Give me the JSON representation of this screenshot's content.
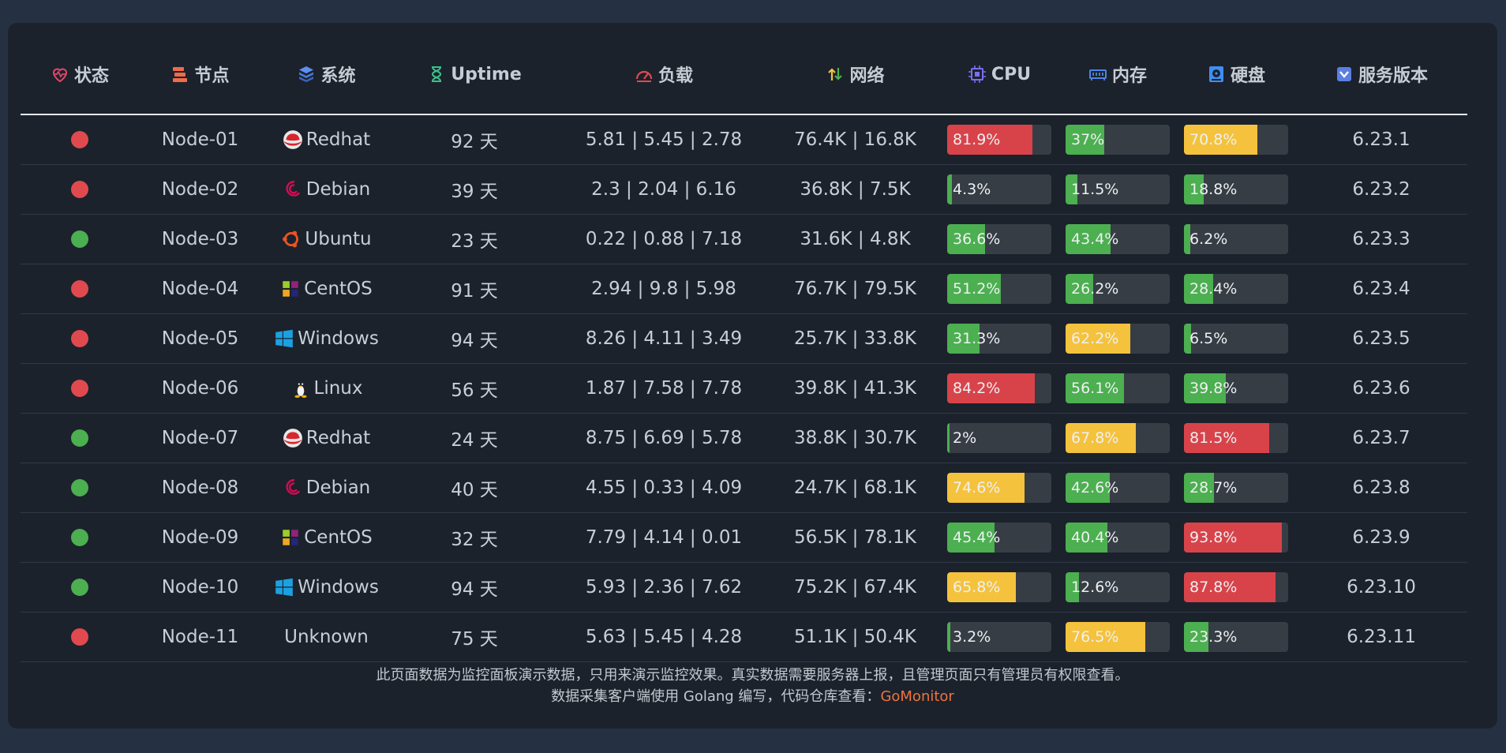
{
  "headers": {
    "status": "状态",
    "node": "节点",
    "system": "系统",
    "uptime": "Uptime",
    "load": "负载",
    "network": "网络",
    "cpu": "CPU",
    "memory": "内存",
    "disk": "硬盘",
    "version": "服务版本"
  },
  "colors": {
    "online": "#4caf50",
    "offline": "#e04a4f",
    "bar_green": "#4caf50",
    "bar_yellow": "#f5c23d",
    "bar_red": "#d8434a",
    "link": "#f0733c"
  },
  "rows": [
    {
      "status": "offline",
      "node": "Node-01",
      "os": "Redhat",
      "os_icon": "redhat-icon",
      "uptime": "92 天",
      "load": "5.81 | 5.45 | 2.78",
      "net": "76.4K | 16.8K",
      "cpu": "81.9%",
      "cpu_value": 81.9,
      "mem": "37%",
      "mem_value": 37,
      "disk": "70.8%",
      "disk_value": 70.8,
      "version": "6.23.1"
    },
    {
      "status": "offline",
      "node": "Node-02",
      "os": "Debian",
      "os_icon": "debian-icon",
      "uptime": "39 天",
      "load": "2.3 | 2.04 | 6.16",
      "net": "36.8K | 7.5K",
      "cpu": "4.3%",
      "cpu_value": 4.3,
      "mem": "11.5%",
      "mem_value": 11.5,
      "disk": "18.8%",
      "disk_value": 18.8,
      "version": "6.23.2"
    },
    {
      "status": "online",
      "node": "Node-03",
      "os": "Ubuntu",
      "os_icon": "ubuntu-icon",
      "uptime": "23 天",
      "load": "0.22 | 0.88 | 7.18",
      "net": "31.6K | 4.8K",
      "cpu": "36.6%",
      "cpu_value": 36.6,
      "mem": "43.4%",
      "mem_value": 43.4,
      "disk": "6.2%",
      "disk_value": 6.2,
      "version": "6.23.3"
    },
    {
      "status": "offline",
      "node": "Node-04",
      "os": "CentOS",
      "os_icon": "centos-icon",
      "uptime": "91 天",
      "load": "2.94 | 9.8 | 5.98",
      "net": "76.7K | 79.5K",
      "cpu": "51.2%",
      "cpu_value": 51.2,
      "mem": "26.2%",
      "mem_value": 26.2,
      "disk": "28.4%",
      "disk_value": 28.4,
      "version": "6.23.4"
    },
    {
      "status": "offline",
      "node": "Node-05",
      "os": "Windows",
      "os_icon": "windows-icon",
      "uptime": "94 天",
      "load": "8.26 | 4.11 | 3.49",
      "net": "25.7K | 33.8K",
      "cpu": "31.3%",
      "cpu_value": 31.3,
      "mem": "62.2%",
      "mem_value": 62.2,
      "disk": "6.5%",
      "disk_value": 6.5,
      "version": "6.23.5"
    },
    {
      "status": "offline",
      "node": "Node-06",
      "os": "Linux",
      "os_icon": "linux-icon",
      "uptime": "56 天",
      "load": "1.87 | 7.58 | 7.78",
      "net": "39.8K | 41.3K",
      "cpu": "84.2%",
      "cpu_value": 84.2,
      "mem": "56.1%",
      "mem_value": 56.1,
      "disk": "39.8%",
      "disk_value": 39.8,
      "version": "6.23.6"
    },
    {
      "status": "online",
      "node": "Node-07",
      "os": "Redhat",
      "os_icon": "redhat-icon",
      "uptime": "24 天",
      "load": "8.75 | 6.69 | 5.78",
      "net": "38.8K | 30.7K",
      "cpu": "2%",
      "cpu_value": 2,
      "mem": "67.8%",
      "mem_value": 67.8,
      "disk": "81.5%",
      "disk_value": 81.5,
      "version": "6.23.7"
    },
    {
      "status": "online",
      "node": "Node-08",
      "os": "Debian",
      "os_icon": "debian-icon",
      "uptime": "40 天",
      "load": "4.55 | 0.33 | 4.09",
      "net": "24.7K | 68.1K",
      "cpu": "74.6%",
      "cpu_value": 74.6,
      "mem": "42.6%",
      "mem_value": 42.6,
      "disk": "28.7%",
      "disk_value": 28.7,
      "version": "6.23.8"
    },
    {
      "status": "online",
      "node": "Node-09",
      "os": "CentOS",
      "os_icon": "centos-icon",
      "uptime": "32 天",
      "load": "7.79 | 4.14 | 0.01",
      "net": "56.5K | 78.1K",
      "cpu": "45.4%",
      "cpu_value": 45.4,
      "mem": "40.4%",
      "mem_value": 40.4,
      "disk": "93.8%",
      "disk_value": 93.8,
      "version": "6.23.9"
    },
    {
      "status": "online",
      "node": "Node-10",
      "os": "Windows",
      "os_icon": "windows-icon",
      "uptime": "94 天",
      "load": "5.93 | 2.36 | 7.62",
      "net": "75.2K | 67.4K",
      "cpu": "65.8%",
      "cpu_value": 65.8,
      "mem": "12.6%",
      "mem_value": 12.6,
      "disk": "87.8%",
      "disk_value": 87.8,
      "version": "6.23.10"
    },
    {
      "status": "offline",
      "node": "Node-11",
      "os": "Unknown",
      "os_icon": "",
      "uptime": "75 天",
      "load": "5.63 | 5.45 | 4.28",
      "net": "51.1K | 50.4K",
      "cpu": "3.2%",
      "cpu_value": 3.2,
      "mem": "76.5%",
      "mem_value": 76.5,
      "disk": "23.3%",
      "disk_value": 23.3,
      "version": "6.23.11"
    }
  ],
  "footer": {
    "line1": "此页面数据为监控面板演示数据，只用来演示监控效果。真实数据需要服务器上报，且管理页面只有管理员有权限查看。",
    "line2_prefix": "数据采集客户端使用 Golang 编写，代码仓库查看：",
    "link_text": "GoMonitor"
  }
}
